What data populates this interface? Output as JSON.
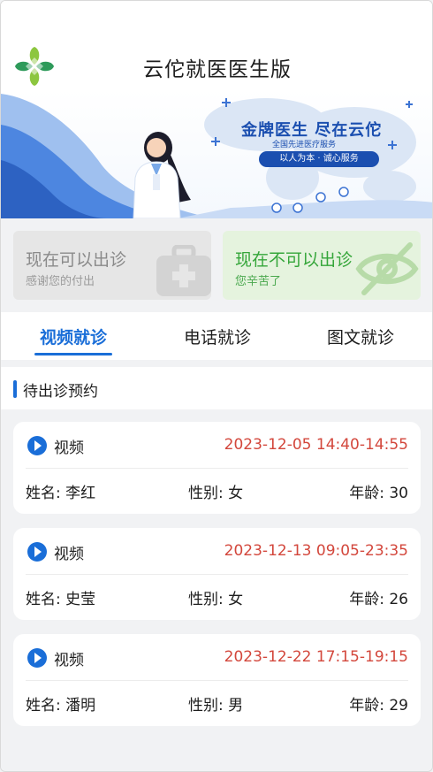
{
  "header": {
    "title": "云佗就医医生版",
    "logo_icon": "clover-leaf-logo"
  },
  "banner": {
    "slogan": "金牌医生 尽在云佗",
    "slogan_sub": "全国先进医疗服务",
    "slogan_pill": "以人为本 · 诚心服务"
  },
  "status": {
    "available": {
      "title": "现在可以出诊",
      "subtitle": "感谢您的付出",
      "icon": "medical-kit-icon"
    },
    "unavailable": {
      "title": "现在不可以出诊",
      "subtitle": "您辛苦了",
      "icon": "eye-off-icon"
    }
  },
  "tabs": [
    {
      "label": "视频就诊",
      "active": true
    },
    {
      "label": "电话就诊",
      "active": false
    },
    {
      "label": "图文就诊",
      "active": false
    }
  ],
  "section": {
    "title": "待出诊预约"
  },
  "appointments": [
    {
      "type": "视频",
      "time": "2023-12-05 14:40-14:55",
      "name": "姓名: 李红",
      "gender": "性别: 女",
      "age": "年龄: 30"
    },
    {
      "type": "视频",
      "time": "2023-12-13 09:05-23:35",
      "name": "姓名: 史莹",
      "gender": "性别: 女",
      "age": "年龄: 26"
    },
    {
      "type": "视频",
      "time": "2023-12-22 17:15-19:15",
      "name": "姓名: 潘明",
      "gender": "性别: 男",
      "age": "年龄: 29"
    }
  ],
  "colors": {
    "accent": "#1a6ed8",
    "time_red": "#d3473c",
    "green": "#35a63a"
  }
}
